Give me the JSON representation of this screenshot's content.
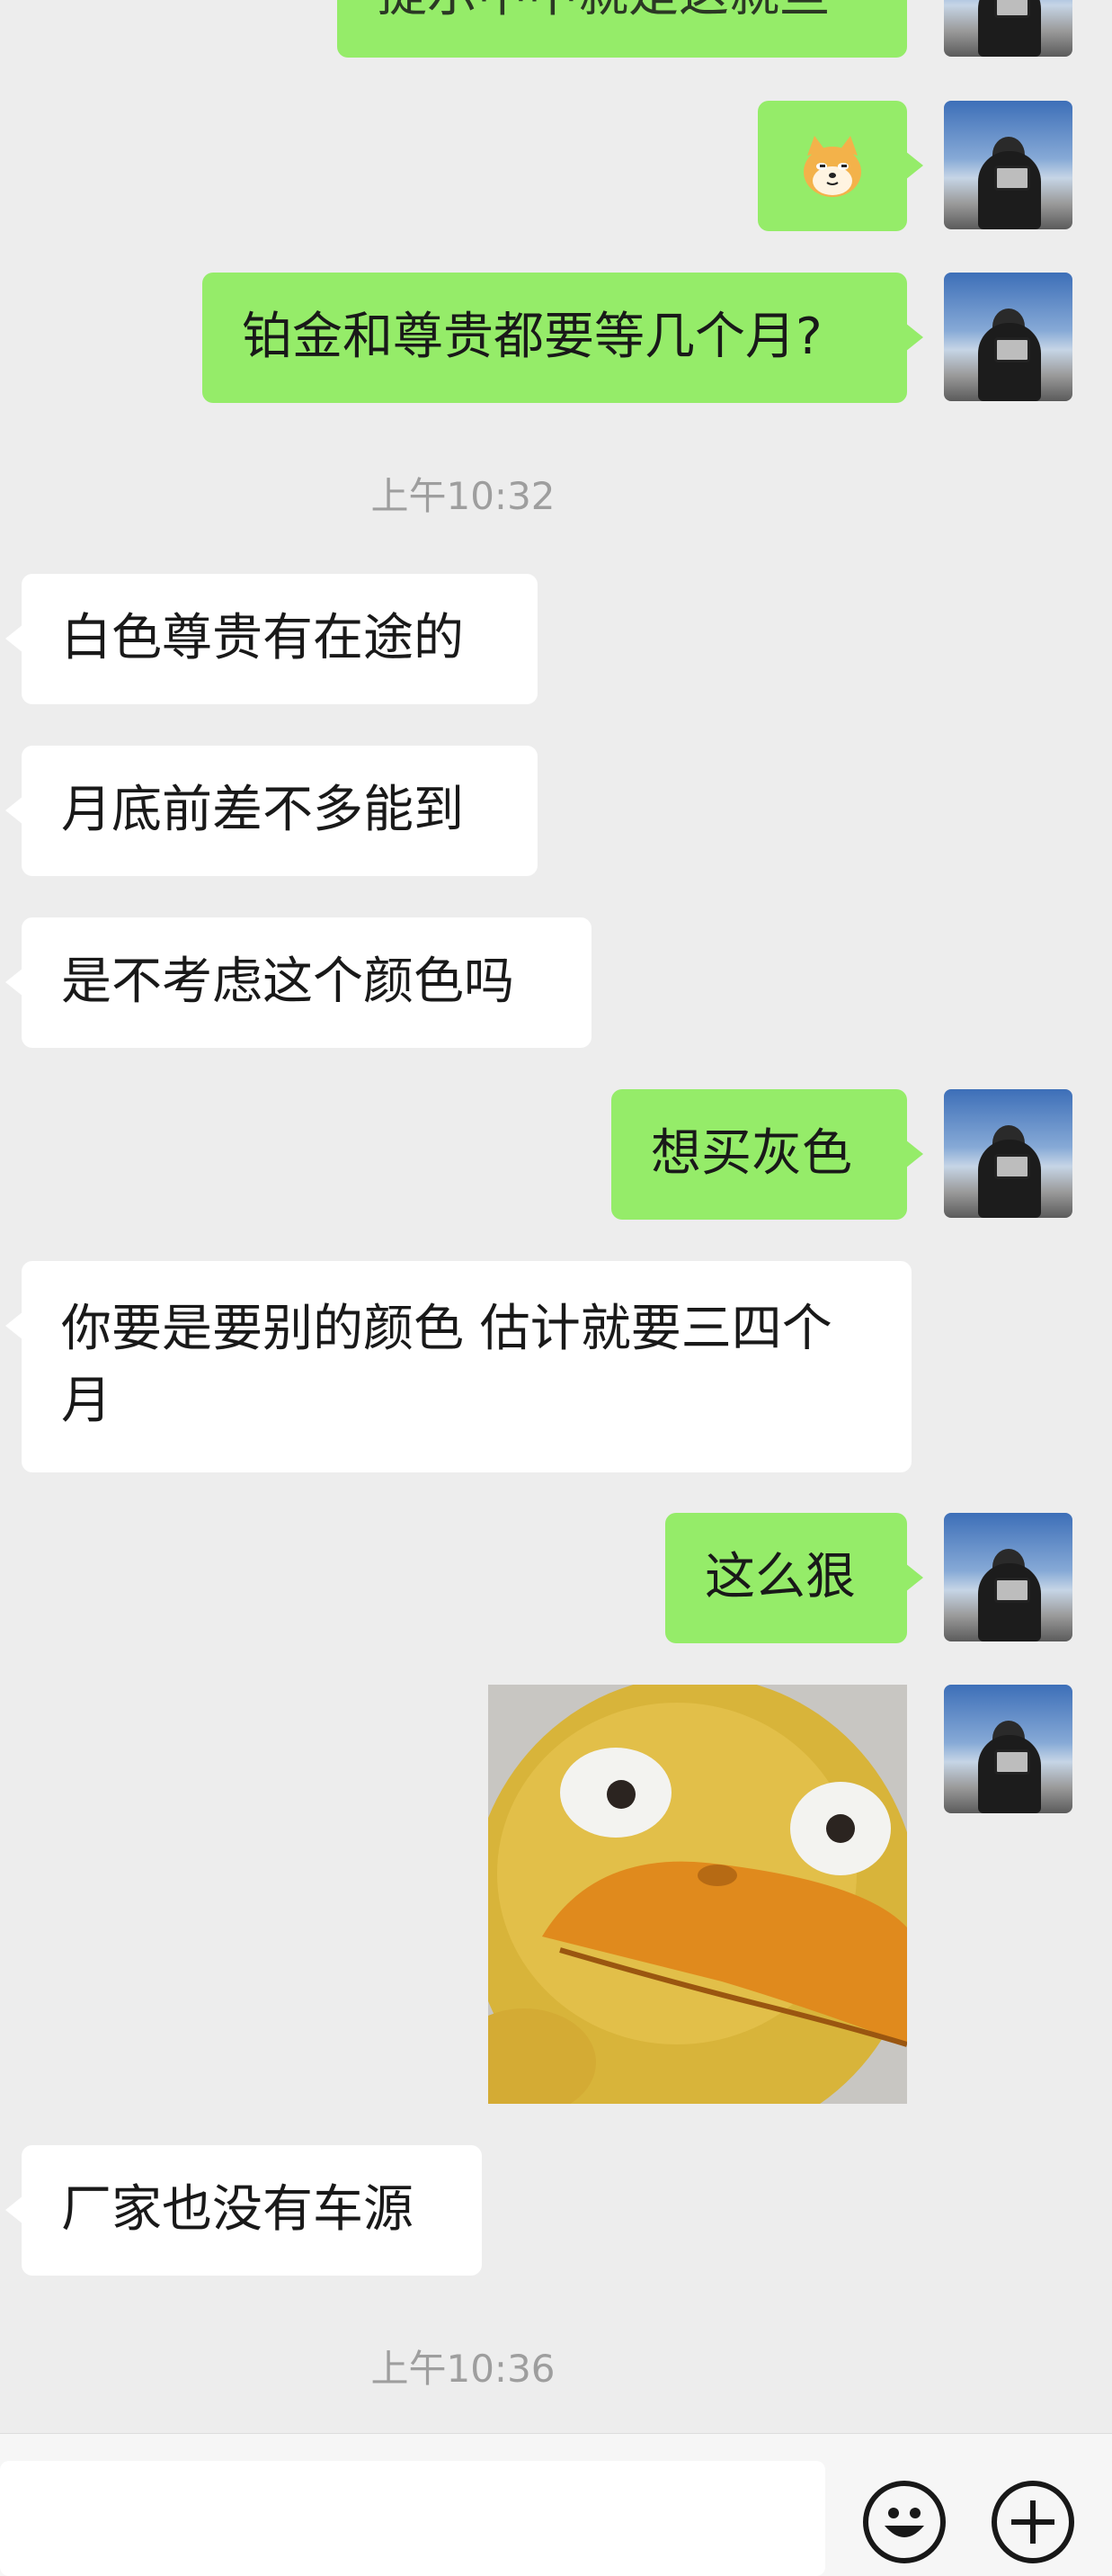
{
  "messages": [
    {
      "side": "me",
      "type": "text",
      "text": "提示中中就是这就些"
    },
    {
      "side": "me",
      "type": "emoji",
      "icon": "shiba-dog-emoji"
    },
    {
      "side": "me",
      "type": "text",
      "text": "铂金和尊贵都要等几个月?"
    },
    {
      "type": "timestamp",
      "text": "上午10:32"
    },
    {
      "side": "them",
      "type": "text",
      "text": "白色尊贵有在途的"
    },
    {
      "side": "them",
      "type": "text",
      "text": "月底前差不多能到"
    },
    {
      "side": "them",
      "type": "text",
      "text": "是不考虑这个颜色吗"
    },
    {
      "side": "me",
      "type": "text",
      "text": "想买灰色"
    },
    {
      "side": "them",
      "type": "text",
      "text": "你要是要别的颜色 估计就要三四个月"
    },
    {
      "side": "me",
      "type": "text",
      "text": "这么狠"
    },
    {
      "side": "me",
      "type": "sticker",
      "icon": "psyduck-sticker"
    },
    {
      "side": "them",
      "type": "text",
      "text": "厂家也没有车源"
    },
    {
      "type": "timestamp",
      "text": "上午10:36"
    }
  ],
  "input": {
    "value": ""
  },
  "toolbar": {
    "emoji_icon": "smiley-icon",
    "plus_icon": "plus-icon"
  },
  "colors": {
    "my_bubble": "#95ec69",
    "their_bubble": "#ffffff",
    "background": "#ededed"
  }
}
